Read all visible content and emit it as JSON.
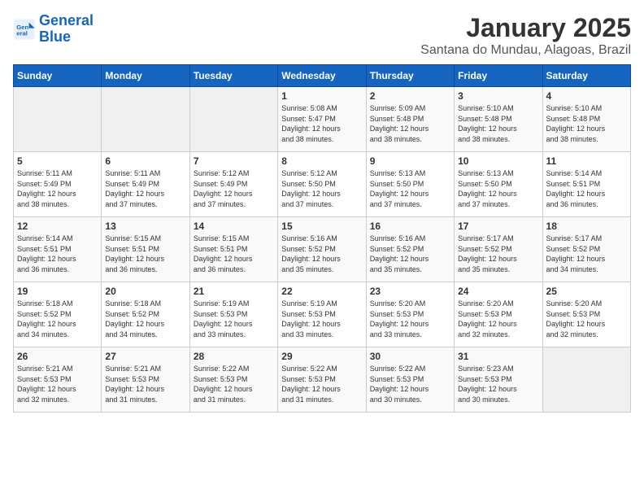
{
  "logo": {
    "line1": "General",
    "line2": "Blue"
  },
  "title": "January 2025",
  "location": "Santana do Mundau, Alagoas, Brazil",
  "weekdays": [
    "Sunday",
    "Monday",
    "Tuesday",
    "Wednesday",
    "Thursday",
    "Friday",
    "Saturday"
  ],
  "weeks": [
    [
      {
        "day": "",
        "info": ""
      },
      {
        "day": "",
        "info": ""
      },
      {
        "day": "",
        "info": ""
      },
      {
        "day": "1",
        "info": "Sunrise: 5:08 AM\nSunset: 5:47 PM\nDaylight: 12 hours\nand 38 minutes."
      },
      {
        "day": "2",
        "info": "Sunrise: 5:09 AM\nSunset: 5:48 PM\nDaylight: 12 hours\nand 38 minutes."
      },
      {
        "day": "3",
        "info": "Sunrise: 5:10 AM\nSunset: 5:48 PM\nDaylight: 12 hours\nand 38 minutes."
      },
      {
        "day": "4",
        "info": "Sunrise: 5:10 AM\nSunset: 5:48 PM\nDaylight: 12 hours\nand 38 minutes."
      }
    ],
    [
      {
        "day": "5",
        "info": "Sunrise: 5:11 AM\nSunset: 5:49 PM\nDaylight: 12 hours\nand 38 minutes."
      },
      {
        "day": "6",
        "info": "Sunrise: 5:11 AM\nSunset: 5:49 PM\nDaylight: 12 hours\nand 37 minutes."
      },
      {
        "day": "7",
        "info": "Sunrise: 5:12 AM\nSunset: 5:49 PM\nDaylight: 12 hours\nand 37 minutes."
      },
      {
        "day": "8",
        "info": "Sunrise: 5:12 AM\nSunset: 5:50 PM\nDaylight: 12 hours\nand 37 minutes."
      },
      {
        "day": "9",
        "info": "Sunrise: 5:13 AM\nSunset: 5:50 PM\nDaylight: 12 hours\nand 37 minutes."
      },
      {
        "day": "10",
        "info": "Sunrise: 5:13 AM\nSunset: 5:50 PM\nDaylight: 12 hours\nand 37 minutes."
      },
      {
        "day": "11",
        "info": "Sunrise: 5:14 AM\nSunset: 5:51 PM\nDaylight: 12 hours\nand 36 minutes."
      }
    ],
    [
      {
        "day": "12",
        "info": "Sunrise: 5:14 AM\nSunset: 5:51 PM\nDaylight: 12 hours\nand 36 minutes."
      },
      {
        "day": "13",
        "info": "Sunrise: 5:15 AM\nSunset: 5:51 PM\nDaylight: 12 hours\nand 36 minutes."
      },
      {
        "day": "14",
        "info": "Sunrise: 5:15 AM\nSunset: 5:51 PM\nDaylight: 12 hours\nand 36 minutes."
      },
      {
        "day": "15",
        "info": "Sunrise: 5:16 AM\nSunset: 5:52 PM\nDaylight: 12 hours\nand 35 minutes."
      },
      {
        "day": "16",
        "info": "Sunrise: 5:16 AM\nSunset: 5:52 PM\nDaylight: 12 hours\nand 35 minutes."
      },
      {
        "day": "17",
        "info": "Sunrise: 5:17 AM\nSunset: 5:52 PM\nDaylight: 12 hours\nand 35 minutes."
      },
      {
        "day": "18",
        "info": "Sunrise: 5:17 AM\nSunset: 5:52 PM\nDaylight: 12 hours\nand 34 minutes."
      }
    ],
    [
      {
        "day": "19",
        "info": "Sunrise: 5:18 AM\nSunset: 5:52 PM\nDaylight: 12 hours\nand 34 minutes."
      },
      {
        "day": "20",
        "info": "Sunrise: 5:18 AM\nSunset: 5:52 PM\nDaylight: 12 hours\nand 34 minutes."
      },
      {
        "day": "21",
        "info": "Sunrise: 5:19 AM\nSunset: 5:53 PM\nDaylight: 12 hours\nand 33 minutes."
      },
      {
        "day": "22",
        "info": "Sunrise: 5:19 AM\nSunset: 5:53 PM\nDaylight: 12 hours\nand 33 minutes."
      },
      {
        "day": "23",
        "info": "Sunrise: 5:20 AM\nSunset: 5:53 PM\nDaylight: 12 hours\nand 33 minutes."
      },
      {
        "day": "24",
        "info": "Sunrise: 5:20 AM\nSunset: 5:53 PM\nDaylight: 12 hours\nand 32 minutes."
      },
      {
        "day": "25",
        "info": "Sunrise: 5:20 AM\nSunset: 5:53 PM\nDaylight: 12 hours\nand 32 minutes."
      }
    ],
    [
      {
        "day": "26",
        "info": "Sunrise: 5:21 AM\nSunset: 5:53 PM\nDaylight: 12 hours\nand 32 minutes."
      },
      {
        "day": "27",
        "info": "Sunrise: 5:21 AM\nSunset: 5:53 PM\nDaylight: 12 hours\nand 31 minutes."
      },
      {
        "day": "28",
        "info": "Sunrise: 5:22 AM\nSunset: 5:53 PM\nDaylight: 12 hours\nand 31 minutes."
      },
      {
        "day": "29",
        "info": "Sunrise: 5:22 AM\nSunset: 5:53 PM\nDaylight: 12 hours\nand 31 minutes."
      },
      {
        "day": "30",
        "info": "Sunrise: 5:22 AM\nSunset: 5:53 PM\nDaylight: 12 hours\nand 30 minutes."
      },
      {
        "day": "31",
        "info": "Sunrise: 5:23 AM\nSunset: 5:53 PM\nDaylight: 12 hours\nand 30 minutes."
      },
      {
        "day": "",
        "info": ""
      }
    ]
  ]
}
